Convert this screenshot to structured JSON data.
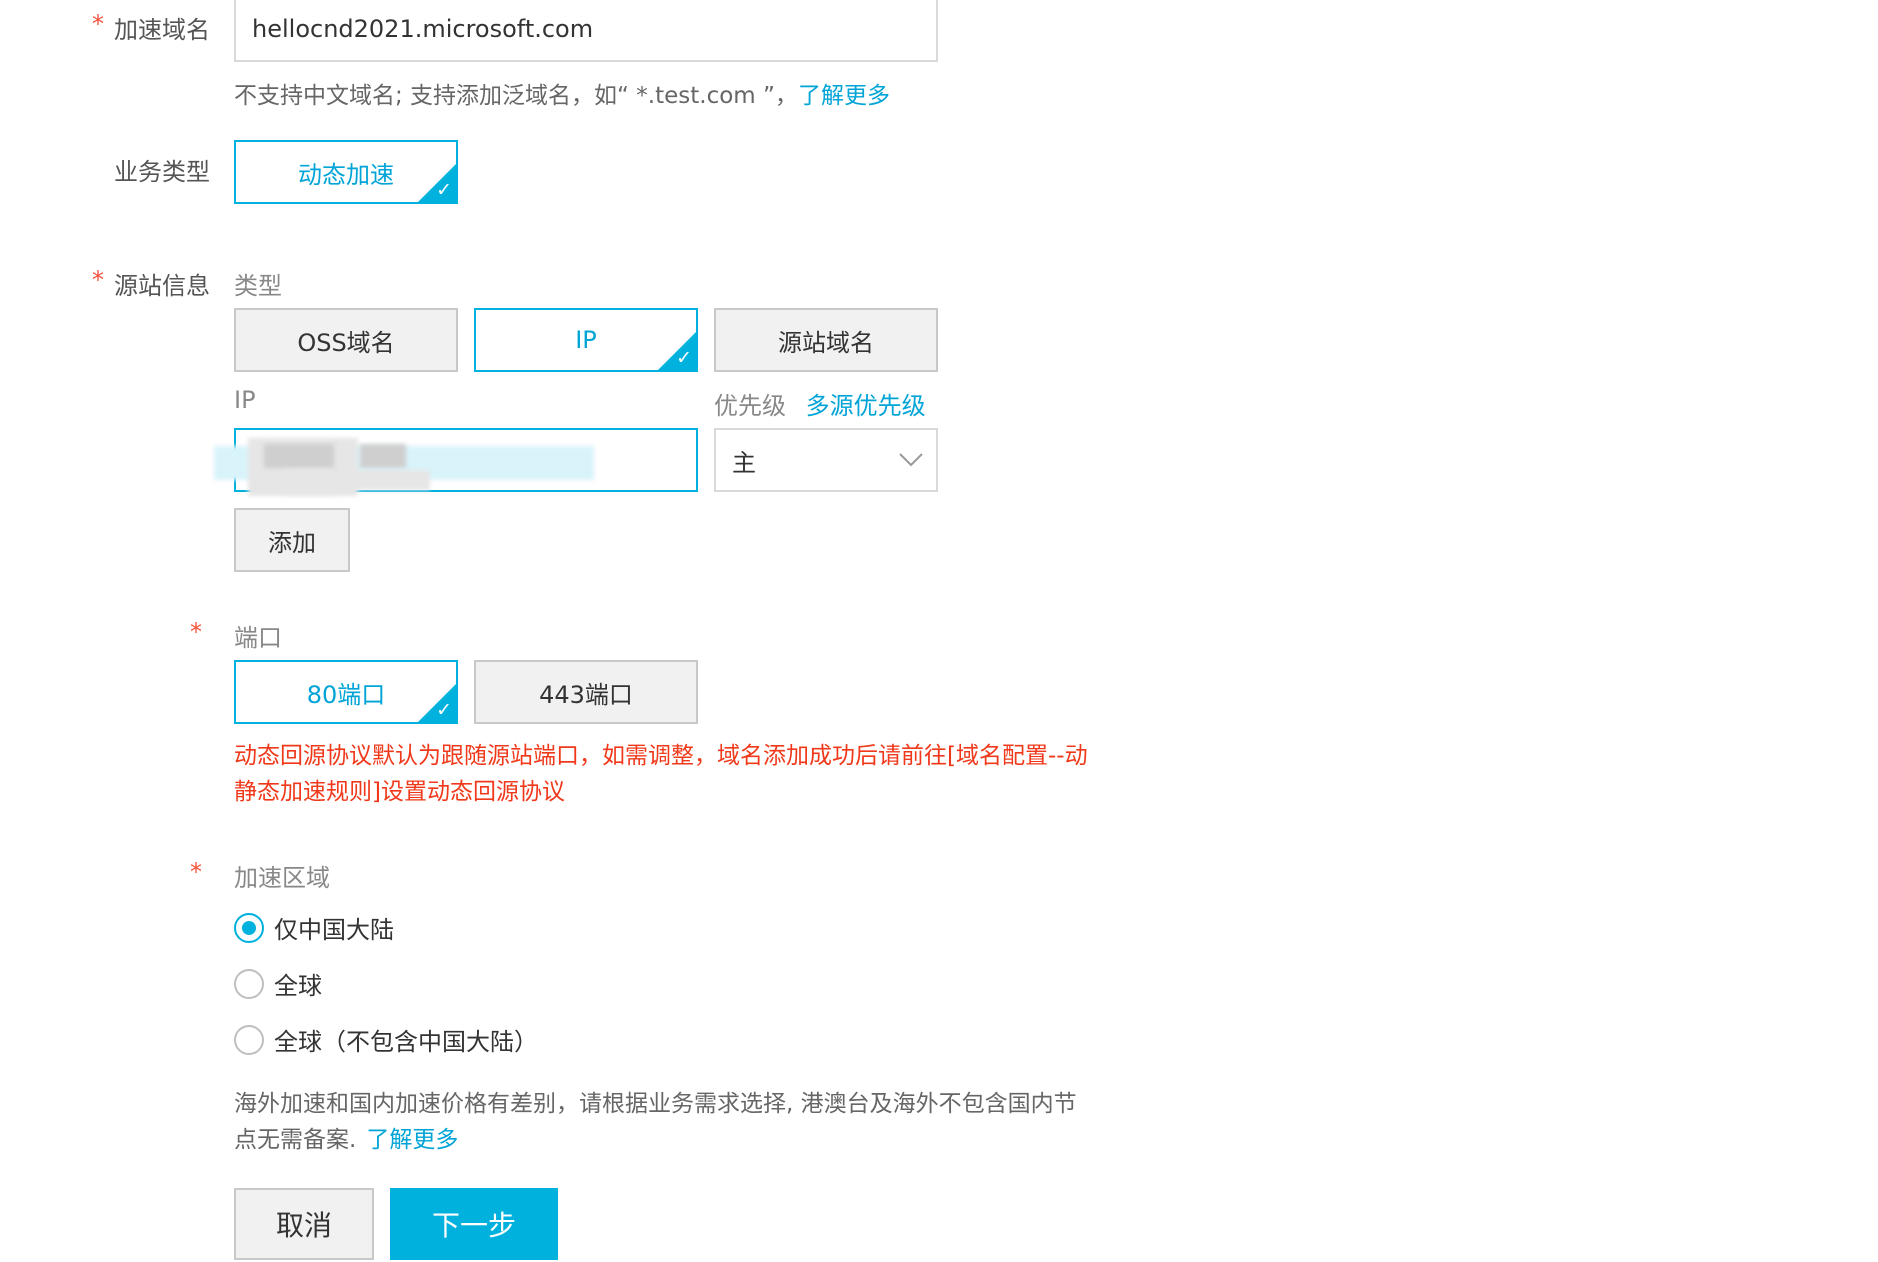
{
  "domain_section": {
    "label": "加速域名",
    "required_mark": "*",
    "value": "hellocnd2021.microsoft.com",
    "hint": "不支持中文域名; 支持添加泛域名，如“ *.test.com ”，",
    "hint_link": "了解更多"
  },
  "business_type": {
    "label": "业务类型",
    "selected_option": "动态加速"
  },
  "origin_info": {
    "label": "源站信息",
    "required_mark": "*",
    "type_label": "类型",
    "type_options": [
      "OSS域名",
      "IP",
      "源站域名"
    ],
    "selected_type": "IP",
    "ip_label": "IP",
    "priority_label": "优先级",
    "priority_link": "多源优先级",
    "priority_value": "主",
    "add_button": "添加"
  },
  "port": {
    "label": "端口",
    "required_mark": "*",
    "options": [
      "80端口",
      "443端口"
    ],
    "selected": "80端口",
    "warning_line1": "动态回源协议默认为跟随源站端口，如需调整，域名添加成功后请前往[域名配置--动",
    "warning_line2": "静态加速规则]设置动态回源协议"
  },
  "region": {
    "label": "加速区域",
    "required_mark": "*",
    "options": [
      "仅中国大陆",
      "全球",
      "全球（不包含中国大陆）"
    ],
    "selected_index": 0,
    "note_line1": "海外加速和国内加速价格有差别，请根据业务需求选择, 港澳台及海外不包含国内节",
    "note_line2": "点无需备案.",
    "note_link": "了解更多"
  },
  "actions": {
    "cancel": "取消",
    "next": "下一步"
  },
  "colors": {
    "accent": "#00b0dd",
    "link": "#00a4d6",
    "required": "#f5533d",
    "warning": "#f0391b"
  }
}
